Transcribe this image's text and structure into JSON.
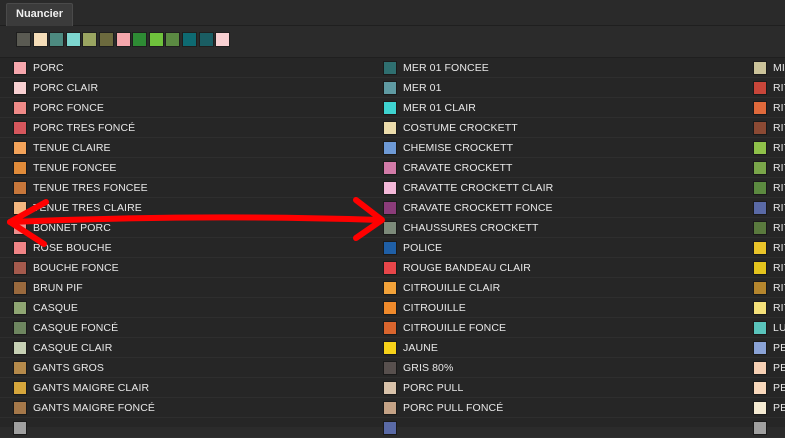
{
  "panel": {
    "tab_label": "Nuancier"
  },
  "recent_swatches": [
    "#5a5a52",
    "#f5ddb8",
    "#4d8a80",
    "#7dd6cf",
    "#9aa561",
    "#6c6a3e",
    "#f5a7ac",
    "#2e8b34",
    "#6fc23c",
    "#5b8a42",
    "#0e6a72",
    "#1a5d63",
    "#f8d0d2"
  ],
  "columns": [
    [
      {
        "label": "PORC",
        "color": "#f6a7ad"
      },
      {
        "label": "PORC CLAIR",
        "color": "#f8d0d2"
      },
      {
        "label": "PORC FONCE",
        "color": "#ef8a88"
      },
      {
        "label": "PORC TRES FONCÉ",
        "color": "#d6575d"
      },
      {
        "label": "TENUE CLAIRE",
        "color": "#f3a35a"
      },
      {
        "label": "TENUE FONCEE",
        "color": "#e08b3a"
      },
      {
        "label": "TENUE TRES FONCEE",
        "color": "#c7773b"
      },
      {
        "label": "TENUE TRES CLAIRE",
        "color": "#f4b780"
      },
      {
        "label": "BONNET PORC",
        "color": "#ec8e8d"
      },
      {
        "label": "ROSE BOUCHE",
        "color": "#f08587"
      },
      {
        "label": "BOUCHE FONCE",
        "color": "#a45a4d"
      },
      {
        "label": "BRUN PIF",
        "color": "#9a6a3e"
      },
      {
        "label": "CASQUE",
        "color": "#8fa673"
      },
      {
        "label": "CASQUE FONCÉ",
        "color": "#6e8660"
      },
      {
        "label": "CASQUE CLAIR",
        "color": "#c6d0b4"
      },
      {
        "label": "GANTS GROS",
        "color": "#b58a4b"
      },
      {
        "label": "GANTS MAIGRE CLAIR",
        "color": "#d6a63c"
      },
      {
        "label": "GANTS MAIGRE FONCÉ",
        "color": "#a5784a"
      },
      {
        "label": "",
        "color": "#a0a0a0"
      }
    ],
    [
      {
        "label": "MER 01 FONCEE",
        "color": "#2f6f70"
      },
      {
        "label": "MER 01",
        "color": "#5f9aa2"
      },
      {
        "label": "MER 01 CLAIR",
        "color": "#3fd3d0"
      },
      {
        "label": "COSTUME CROCKETT",
        "color": "#ebdcab"
      },
      {
        "label": "CHEMISE CROCKETT",
        "color": "#6e9ad6"
      },
      {
        "label": "CRAVATE CROCKETT",
        "color": "#d27ba8"
      },
      {
        "label": "CRAVATTE CROCKETT CLAIR",
        "color": "#f3b8d8"
      },
      {
        "label": "CRAVATE CROCKETT FONCE",
        "color": "#8b3c7a"
      },
      {
        "label": "CHAUSSURES CROCKETT",
        "color": "#7c8a7a"
      },
      {
        "label": "POLICE",
        "color": "#1f5fa6"
      },
      {
        "label": "ROUGE BANDEAU CLAIR",
        "color": "#e8464a"
      },
      {
        "label": "CITROUILLE CLAIR",
        "color": "#f2a23a"
      },
      {
        "label": "CITROUILLE",
        "color": "#ef8a2c"
      },
      {
        "label": "CITROUILLE FONCE",
        "color": "#d9652e"
      },
      {
        "label": "JAUNE",
        "color": "#f7d21a"
      },
      {
        "label": "GRIS 80%",
        "color": "#58504e"
      },
      {
        "label": "PORC PULL",
        "color": "#d8c2aa"
      },
      {
        "label": "PORC PULL FONCÉ",
        "color": "#c4a286"
      },
      {
        "label": "",
        "color": "#5a6aa6"
      }
    ],
    [
      {
        "label": "MI",
        "color": "#cbc39a"
      },
      {
        "label": "RIT",
        "color": "#c8463a"
      },
      {
        "label": "RIT",
        "color": "#e06a3c"
      },
      {
        "label": "RIT",
        "color": "#8c4a34"
      },
      {
        "label": "RIT",
        "color": "#8fc14a"
      },
      {
        "label": "RIT",
        "color": "#7aa64a"
      },
      {
        "label": "RIT",
        "color": "#5c8a40"
      },
      {
        "label": "RIT",
        "color": "#5a6aa6"
      },
      {
        "label": "RIT",
        "color": "#5a7a3e"
      },
      {
        "label": "RIT",
        "color": "#e9c42a"
      },
      {
        "label": "RIT",
        "color": "#e4c41e"
      },
      {
        "label": "RIT",
        "color": "#b5862e"
      },
      {
        "label": "RIT",
        "color": "#f4e07a"
      },
      {
        "label": "LU",
        "color": "#5ac4bc"
      },
      {
        "label": "PE",
        "color": "#8aa2d6"
      },
      {
        "label": "PE",
        "color": "#f6d0b4"
      },
      {
        "label": "PE",
        "color": "#f8d8bc"
      },
      {
        "label": "PE",
        "color": "#f4ead2"
      },
      {
        "label": "",
        "color": "#a0a0a0"
      }
    ]
  ],
  "annotation": {
    "type": "double-headed arrow",
    "color": "#ff0000"
  }
}
